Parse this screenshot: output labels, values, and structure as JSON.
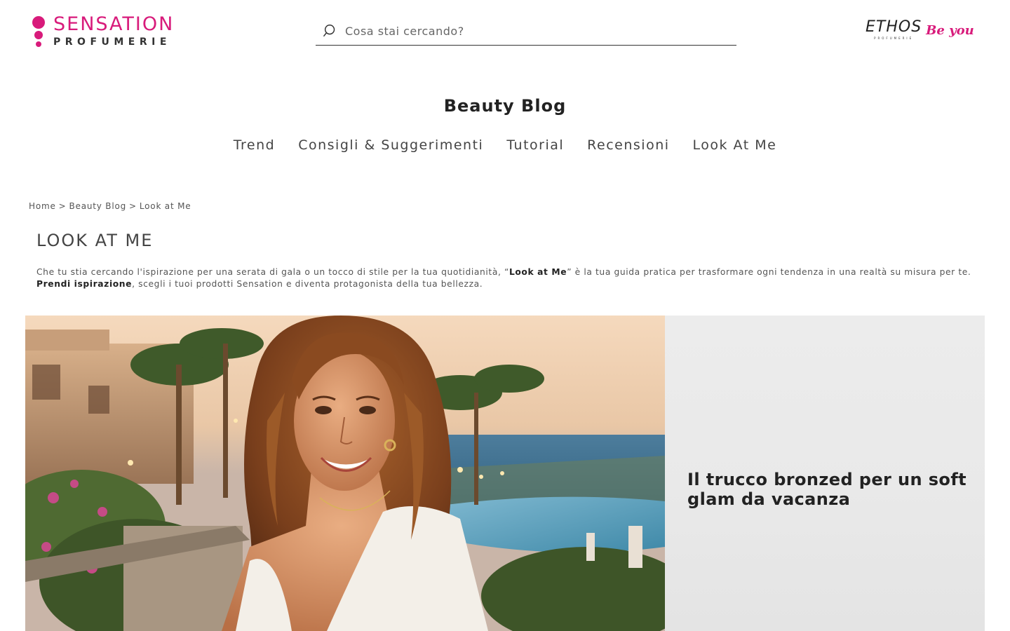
{
  "header": {
    "logo": {
      "main": "SENSATION",
      "sub": "PROFUMERIE"
    },
    "search": {
      "placeholder": "Cosa stai cercando?"
    },
    "partner_logo": {
      "name": "ETHOS",
      "sub": "PROFUMERIE",
      "tagline": "Be you"
    }
  },
  "blog": {
    "title": "Beauty Blog",
    "nav": [
      "Trend",
      "Consigli & Suggerimenti",
      "Tutorial",
      "Recensioni",
      "Look At Me"
    ]
  },
  "breadcrumb": [
    "Home",
    "Beauty Blog",
    "Look at Me"
  ],
  "breadcrumb_separator": ">",
  "page": {
    "title": "LOOK AT ME",
    "intro": {
      "part1": "Che tu stia cercando l'ispirazione per una serata di gala o un tocco di stile per la tua quotidianità, “",
      "bold1": "Look at Me",
      "part2": "” è la tua guida pratica per trasformare ogni tendenza in una realtà su misura per te.",
      "bold2": "Prendi ispirazione",
      "part3": ", scegli i tuoi prodotti Sensation e diventa protagonista della tua bellezza."
    }
  },
  "featured": {
    "title": "Il trucco bronzed per un soft glam da vacanza"
  },
  "colors": {
    "brand": "#d81b7b",
    "text": "#333333",
    "panel": "#ebebeb"
  }
}
